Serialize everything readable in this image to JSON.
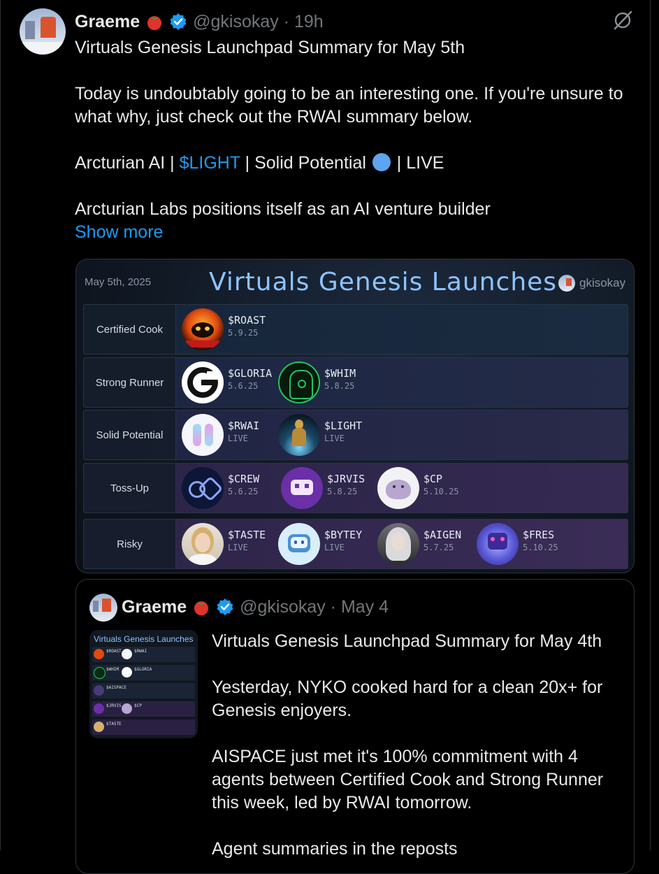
{
  "tweet": {
    "author_name": "Graeme",
    "handle_line": "@gkisokay · 19h",
    "text_p1": "Virtuals Genesis Launchpad Summary for May 5th",
    "text_p2": "Today is undoubtably going to be an interesting one. If you're unsure to what why, just check out the RWAI summary below.",
    "text_p3_before": "Arcturian AI | ",
    "text_p3_cashtag": "$LIGHT",
    "text_p3_after": " | Solid Potential ",
    "text_p3_end": " | LIVE",
    "text_p4": "Arcturian Labs positions itself as an AI venture builder",
    "show_more": "Show more"
  },
  "media": {
    "date": "May 5th, 2025",
    "title": "Virtuals Genesis Launches",
    "credit": "gkisokay",
    "tiers": [
      {
        "label": "Certified Cook",
        "tokens": [
          {
            "tag": "$ROAST",
            "date": "5.9.25",
            "icon": "roast-icon"
          }
        ]
      },
      {
        "label": "Strong Runner",
        "tokens": [
          {
            "tag": "$GLORIA",
            "date": "5.6.25",
            "icon": "gloria-icon"
          },
          {
            "tag": "$WHIM",
            "date": "5.8.25",
            "icon": "whim-icon"
          }
        ]
      },
      {
        "label": "Solid Potential",
        "tokens": [
          {
            "tag": "$RWAI",
            "date": "LIVE",
            "icon": "rwai-icon"
          },
          {
            "tag": "$LIGHT",
            "date": "LIVE",
            "icon": "light-icon"
          }
        ]
      },
      {
        "label": "Toss-Up",
        "tokens": [
          {
            "tag": "$CREW",
            "date": "5.6.25",
            "icon": "crew-icon"
          },
          {
            "tag": "$JRVIS",
            "date": "5.8.25",
            "icon": "jrvis-icon"
          },
          {
            "tag": "$CP",
            "date": "5.10.25",
            "icon": "cp-icon"
          }
        ]
      },
      {
        "label": "Risky",
        "tokens": [
          {
            "tag": "$TASTE",
            "date": "LIVE",
            "icon": "taste-icon"
          },
          {
            "tag": "$BYTEY",
            "date": "LIVE",
            "icon": "bytey-icon"
          },
          {
            "tag": "$AIGEN",
            "date": "5.7.25",
            "icon": "aigen-icon"
          },
          {
            "tag": "$FRES",
            "date": "5.10.25",
            "icon": "fres-icon"
          }
        ]
      }
    ]
  },
  "quote": {
    "author_name": "Graeme",
    "handle_line": "@gkisokay · May 4",
    "thumb_title": "Virtuals Genesis Launches",
    "thumb_labels": [
      "$ROAST",
      "$RWAI",
      "$WHIM",
      "$GLORIA",
      "$AISPACE",
      "$JRVIS",
      "$CP",
      "$TASTE"
    ],
    "text_p1": "Virtuals Genesis Launchpad Summary for May 4th",
    "text_p2": "Yesterday, NYKO cooked hard for a clean 20x+ for Genesis enjoyers.",
    "text_p3": "AISPACE just met it's 100% commitment with 4 agents between Certified Cook and Strong Runner this week, led by RWAI tomorrow.",
    "text_p4": "Agent summaries in the reposts"
  },
  "colors": {
    "link": "#1d9bf0",
    "verified": "#1d9bf0",
    "muted": "#71767b",
    "title_glow": "#8ec3ff"
  }
}
